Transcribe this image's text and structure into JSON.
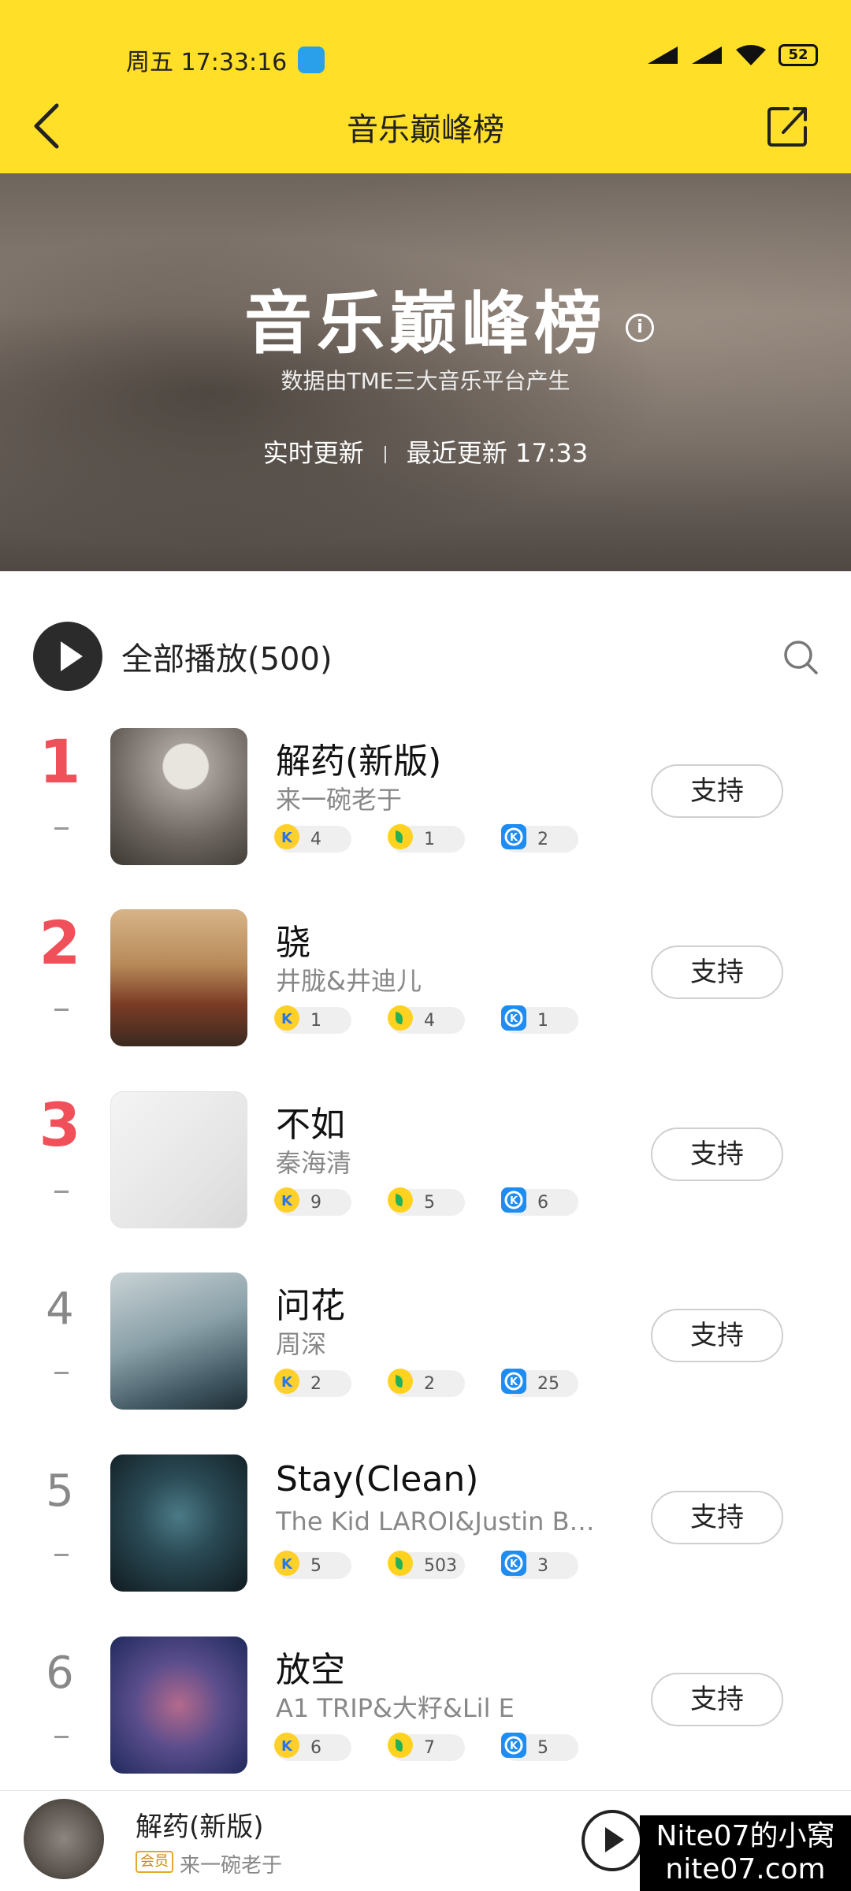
{
  "status": {
    "time": "周五 17:33:16",
    "battery": "52"
  },
  "nav": {
    "title": "音乐巅峰榜"
  },
  "hero": {
    "title": "音乐巅峰榜",
    "subtitle": "数据由TME三大音乐平台产生",
    "realtime": "实时更新",
    "last_update": "最近更新 17:33"
  },
  "playall": {
    "label": "全部播放(500)"
  },
  "songs": [
    {
      "rank": "1",
      "title": "解药(新版)",
      "artist": "来一碗老于",
      "kg": "4",
      "qq": "1",
      "kw": "2",
      "support": "支持"
    },
    {
      "rank": "2",
      "title": "骁",
      "artist": "井胧&井迪儿",
      "kg": "1",
      "qq": "4",
      "kw": "1",
      "support": "支持"
    },
    {
      "rank": "3",
      "title": "不如",
      "artist": "秦海清",
      "kg": "9",
      "qq": "5",
      "kw": "6",
      "support": "支持"
    },
    {
      "rank": "4",
      "title": "问花",
      "artist": "周深",
      "kg": "2",
      "qq": "2",
      "kw": "25",
      "support": "支持"
    },
    {
      "rank": "5",
      "title": "Stay(Clean)",
      "artist": "The Kid LAROI&Justin B…",
      "kg": "5",
      "qq": "503",
      "kw": "3",
      "support": "支持"
    },
    {
      "rank": "6",
      "title": "放空",
      "artist": "A1 TRIP&大籽&Lil E",
      "kg": "6",
      "qq": "7",
      "kw": "5",
      "support": "支持"
    }
  ],
  "player": {
    "title": "解药(新版)",
    "vip": "会员",
    "artist": "来一碗老于"
  },
  "watermark": {
    "line1": "Nite07的小窝",
    "line2": "nite07.com"
  },
  "colors": {
    "header": "#ffdf27",
    "top_rank": "#f0505a"
  }
}
